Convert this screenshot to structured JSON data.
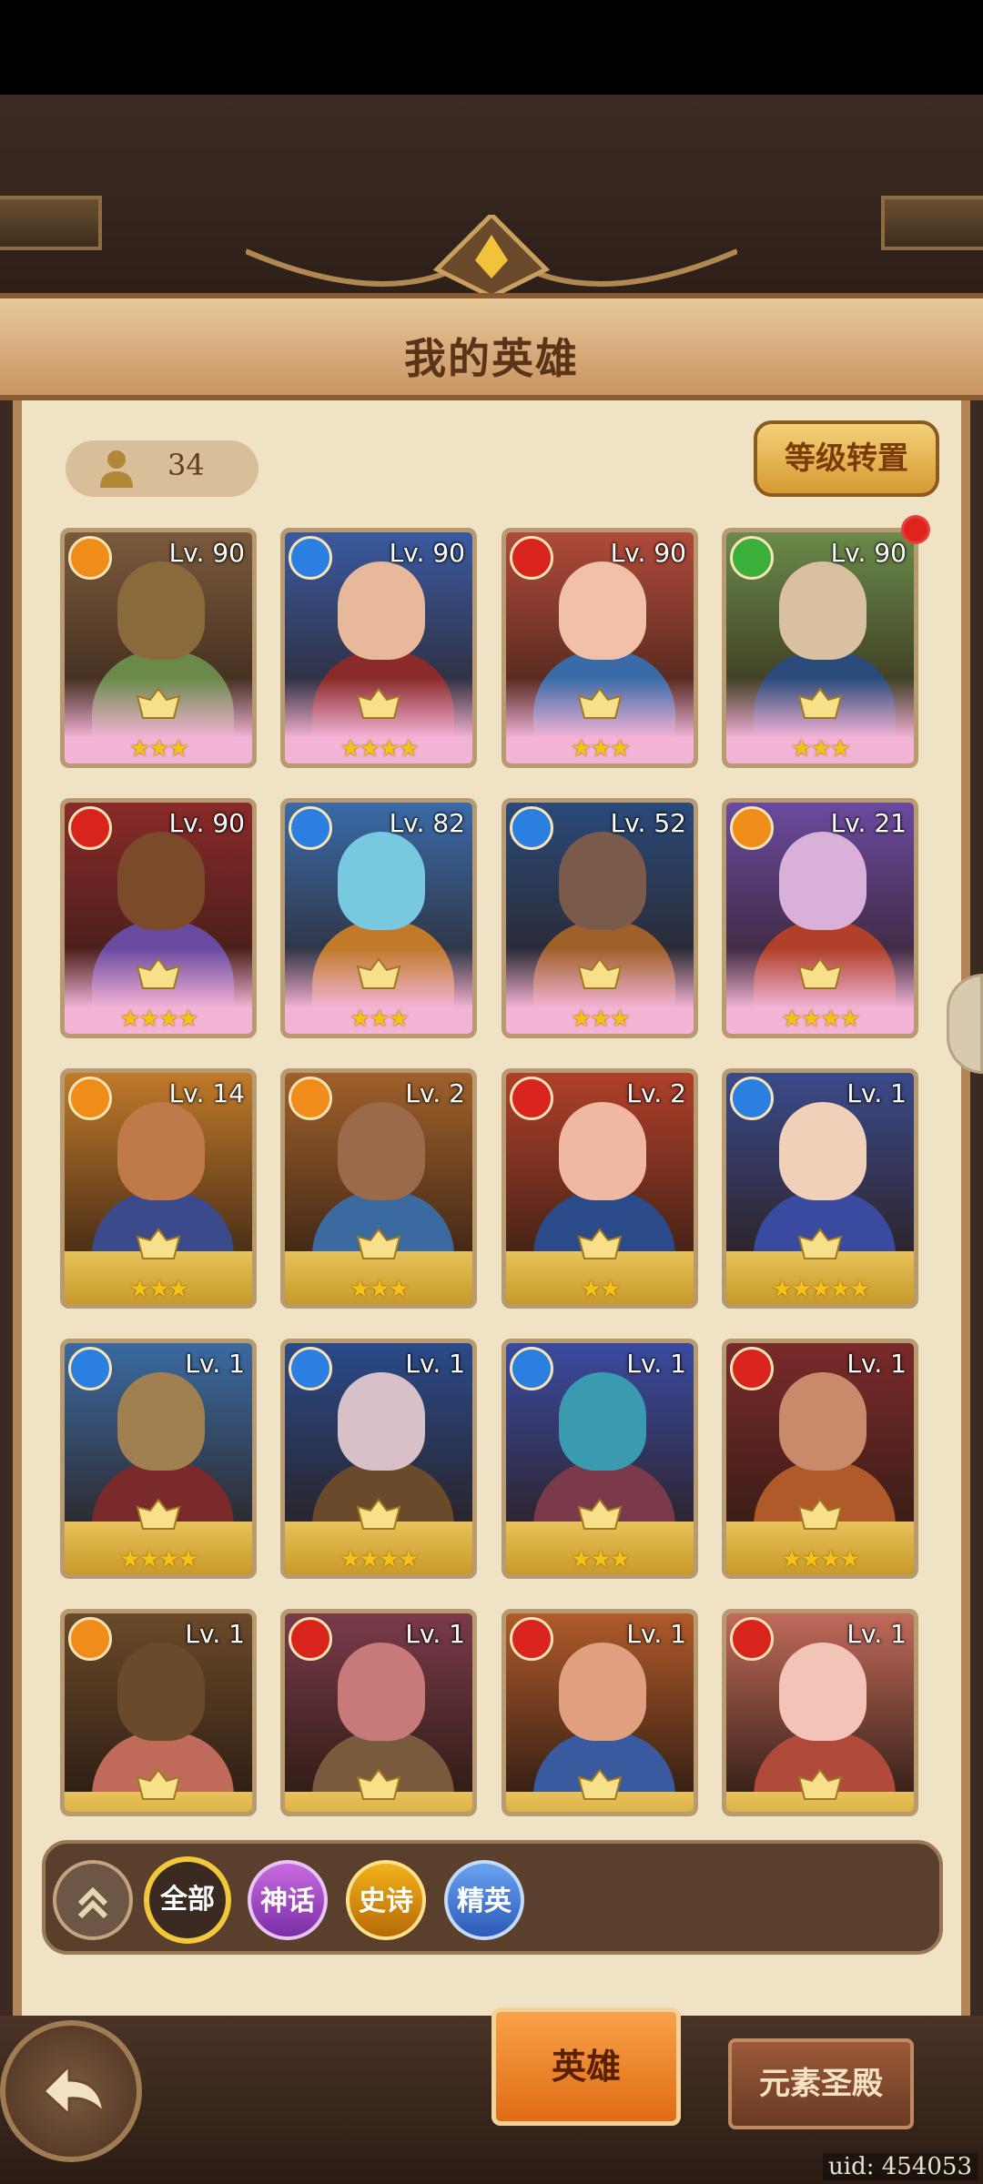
{
  "header": {
    "title": "我的英雄"
  },
  "hero_count": "34",
  "level_reset_button": "等级转置",
  "filters": {
    "all": "全部",
    "myth": "神话",
    "epic": "史诗",
    "elite": "精英"
  },
  "tabs": {
    "heroes": "英雄",
    "element_temple": "元素圣殿"
  },
  "uid": "uid: 454053",
  "heroes": [
    {
      "level": "Lv. 90",
      "element": "earth",
      "stars": "★★★",
      "tier": "wing"
    },
    {
      "level": "Lv. 90",
      "element": "water",
      "stars": "★★★★",
      "tier": "wing"
    },
    {
      "level": "Lv. 90",
      "element": "fire",
      "stars": "★★★",
      "tier": "wing"
    },
    {
      "level": "Lv. 90",
      "element": "nature",
      "stars": "★★★",
      "tier": "wing"
    },
    {
      "level": "Lv. 90",
      "element": "fire",
      "stars": "★★★★",
      "tier": "wing"
    },
    {
      "level": "Lv. 82",
      "element": "water",
      "stars": "★★★",
      "tier": "wing"
    },
    {
      "level": "Lv. 52",
      "element": "water",
      "stars": "★★★",
      "tier": "wing"
    },
    {
      "level": "Lv. 21",
      "element": "earth",
      "stars": "★★★★",
      "tier": "wing"
    },
    {
      "level": "Lv. 14",
      "element": "earth",
      "stars": "★★★",
      "tier": "gold"
    },
    {
      "level": "Lv. 2",
      "element": "earth",
      "stars": "★★★",
      "tier": "gold"
    },
    {
      "level": "Lv. 2",
      "element": "fire",
      "stars": "★★",
      "tier": "gold"
    },
    {
      "level": "Lv. 1",
      "element": "water",
      "stars": "★★★★★",
      "tier": "gold"
    },
    {
      "level": "Lv. 1",
      "element": "water",
      "stars": "★★★★",
      "tier": "gold"
    },
    {
      "level": "Lv. 1",
      "element": "water",
      "stars": "★★★★",
      "tier": "gold"
    },
    {
      "level": "Lv. 1",
      "element": "water",
      "stars": "★★★",
      "tier": "gold"
    },
    {
      "level": "Lv. 1",
      "element": "fire",
      "stars": "★★★★",
      "tier": "gold"
    },
    {
      "level": "Lv. 1",
      "element": "earth",
      "stars": "",
      "tier": "gold"
    },
    {
      "level": "Lv. 1",
      "element": "fire",
      "stars": "",
      "tier": "gold"
    },
    {
      "level": "Lv. 1",
      "element": "fire",
      "stars": "",
      "tier": "gold"
    },
    {
      "level": "Lv. 1",
      "element": "fire",
      "stars": "",
      "tier": "gold"
    }
  ],
  "colors": {
    "earth": "#f08c1a",
    "water": "#2b7fe0",
    "fire": "#d8241c",
    "nature": "#3ab03a"
  }
}
